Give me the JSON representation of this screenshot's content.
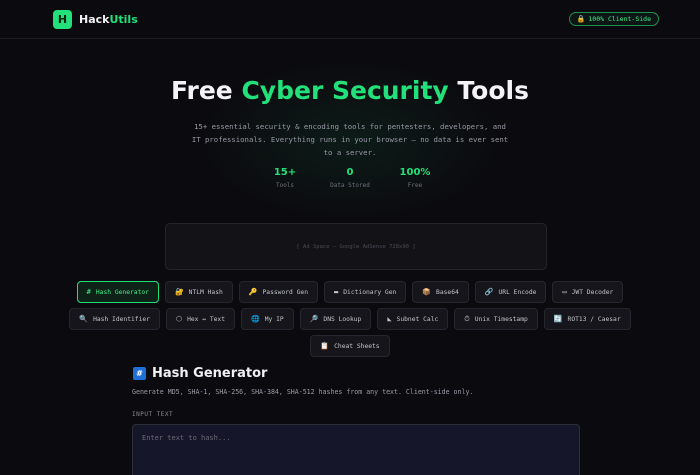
{
  "header": {
    "logo_letter": "H",
    "brand_prefix": "Hack",
    "brand_suffix": "Utils",
    "badge_icon": "lock-icon",
    "badge_text": "100% Client-Side"
  },
  "hero": {
    "title_pre": "Free ",
    "title_highlight": "Cyber Security",
    "title_post": " Tools",
    "subtitle": "15+ essential security & encoding tools for pentesters, developers, and IT professionals. Everything runs in your browser — no data is ever sent to a server.",
    "stats": [
      {
        "value": "15+",
        "label": "Tools"
      },
      {
        "value": "0",
        "label": "Data Stored"
      },
      {
        "value": "100%",
        "label": "Free"
      }
    ]
  },
  "ad": {
    "text": "[ Ad Space — Google AdSense 728x90 ]"
  },
  "tools": {
    "row1": [
      {
        "icon": "#",
        "label": "Hash Generator",
        "active": true
      },
      {
        "icon": "🔐",
        "label": "NTLM Hash"
      },
      {
        "icon": "🔑",
        "label": "Password Gen"
      },
      {
        "icon": "▬",
        "label": "Dictionary Gen"
      },
      {
        "icon": "📦",
        "label": "Base64"
      },
      {
        "icon": "🔗",
        "label": "URL Encode"
      },
      {
        "icon": "▭",
        "label": "JWT Decoder"
      }
    ],
    "row2": [
      {
        "icon": "🔍",
        "label": "Hash Identifier"
      },
      {
        "icon": "⬡",
        "label": "Hex ↔ Text"
      },
      {
        "icon": "🌐",
        "label": "My IP"
      },
      {
        "icon": "🔎",
        "label": "DNS Lookup"
      },
      {
        "icon": "◣",
        "label": "Subnet Calc"
      },
      {
        "icon": "⏱",
        "label": "Unix Timestamp"
      },
      {
        "icon": "🔄",
        "label": "ROT13 / Caesar"
      }
    ],
    "row3": [
      {
        "icon": "📋",
        "label": "Cheat Sheets"
      }
    ]
  },
  "section": {
    "icon": "#",
    "title": "Hash Generator",
    "description": "Generate MD5, SHA-1, SHA-256, SHA-384, SHA-512 hashes from any text. Client-side only.",
    "input_label": "INPUT TEXT",
    "input_placeholder": "Enter text to hash...",
    "input_value": ""
  }
}
